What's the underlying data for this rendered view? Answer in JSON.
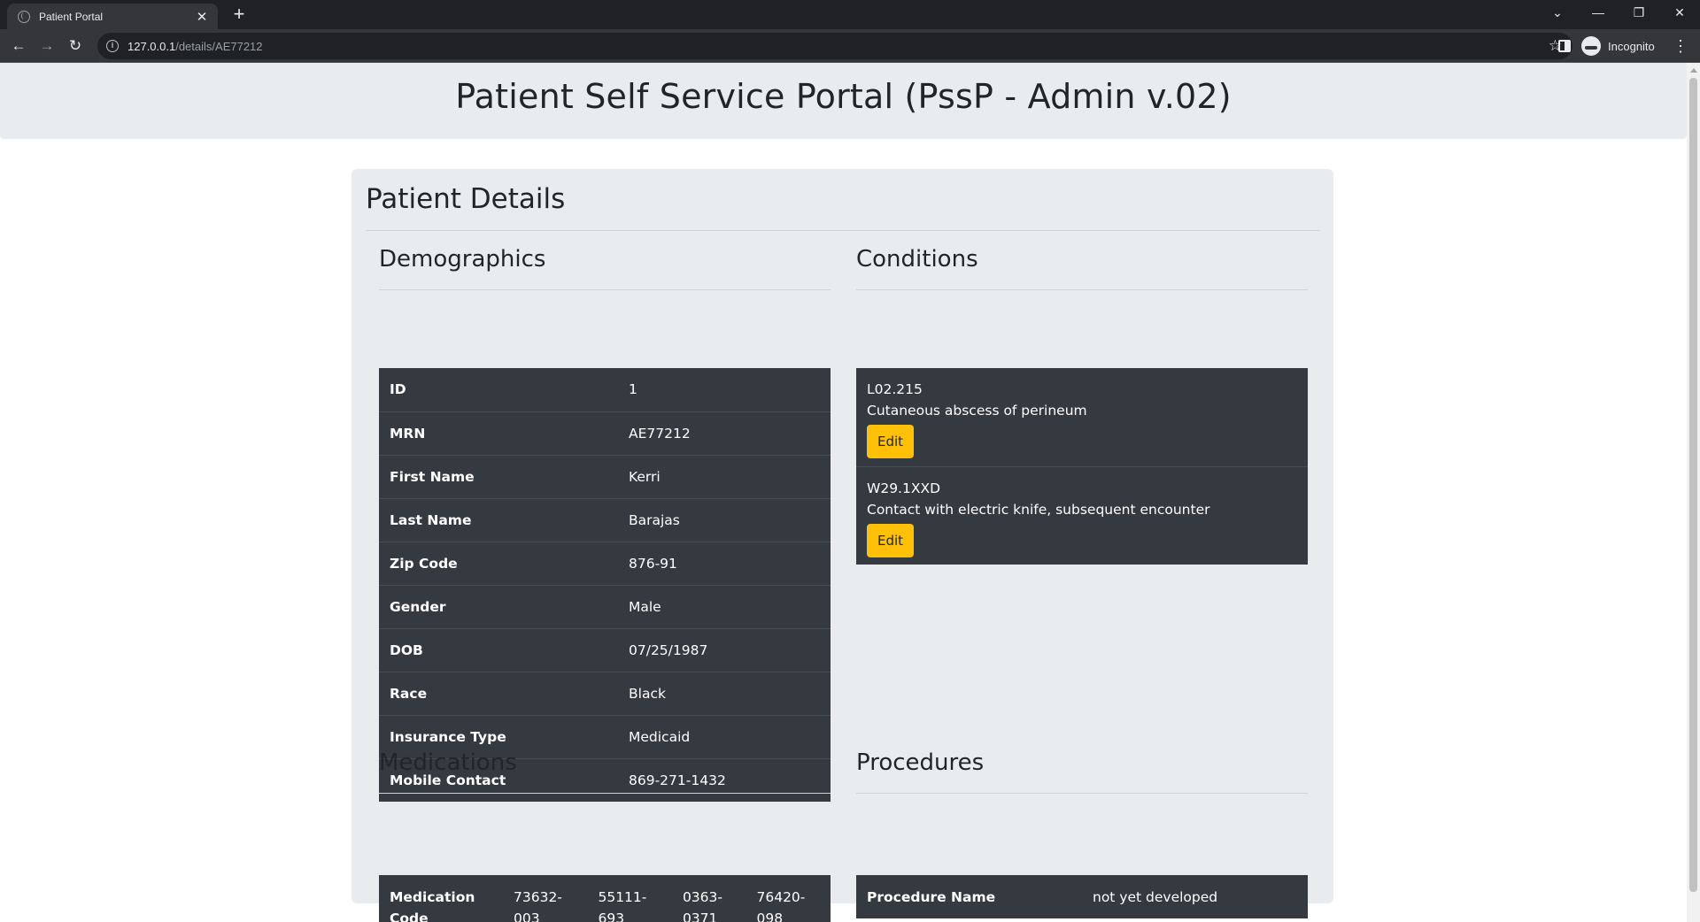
{
  "browser": {
    "tab_title": "Patient Portal",
    "tab_close": "✕",
    "new_tab": "+",
    "url_host": "127.0.0.1",
    "url_path": "/details/AE77212",
    "incognito_label": "Incognito",
    "window_controls": {
      "tab_search": "⌄",
      "minimize": "—",
      "restore": "❐",
      "close": "✕"
    }
  },
  "header": {
    "title": "Patient Self Service Portal (PssP - Admin v.02)"
  },
  "card": {
    "title": "Patient Details",
    "demographics": {
      "title": "Demographics",
      "rows": [
        {
          "key": "ID",
          "value": "1"
        },
        {
          "key": "MRN",
          "value": "AE77212"
        },
        {
          "key": "First Name",
          "value": "Kerri"
        },
        {
          "key": "Last Name",
          "value": "Barajas"
        },
        {
          "key": "Zip Code",
          "value": "876-91"
        },
        {
          "key": "Gender",
          "value": "Male"
        },
        {
          "key": "DOB",
          "value": "07/25/1987"
        },
        {
          "key": "Race",
          "value": "Black"
        },
        {
          "key": "Insurance Type",
          "value": "Medicaid"
        },
        {
          "key": "Mobile Contact",
          "value": "869-271-1432"
        }
      ]
    },
    "conditions": {
      "title": "Conditions",
      "items": [
        {
          "code": "L02.215",
          "description": "Cutaneous abscess of perineum",
          "button": "Edit"
        },
        {
          "code": "W29.1XXD",
          "description": "Contact with electric knife, subsequent encounter",
          "button": "Edit"
        }
      ]
    },
    "medications": {
      "title": "Medications",
      "key_line1": "Medication",
      "key_line2": "Code",
      "codes": [
        {
          "line1": "73632-",
          "line2": "003"
        },
        {
          "line1": "55111-",
          "line2": "693"
        },
        {
          "line1": "0363-",
          "line2": "0371"
        },
        {
          "line1": "76420-",
          "line2": "098"
        }
      ]
    },
    "procedures": {
      "title": "Procedures",
      "key": "Procedure Name",
      "value": "not yet developed"
    }
  }
}
